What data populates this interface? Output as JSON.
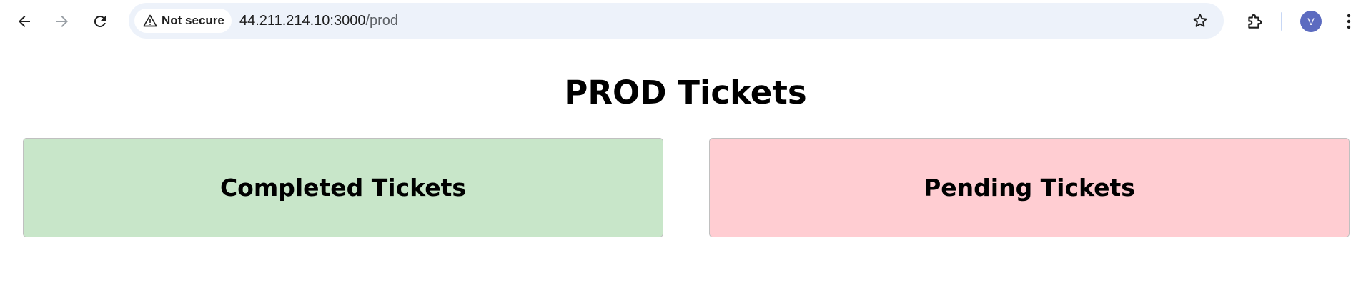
{
  "browser": {
    "security_label": "Not secure",
    "url_host": "44.211.214.10:3000",
    "url_path": "/prod",
    "avatar_letter": "V",
    "icons": {
      "back": "arrow-left-icon",
      "forward": "arrow-right-icon",
      "reload": "reload-icon",
      "security": "warning-triangle-icon",
      "bookmark": "star-icon",
      "extensions": "puzzle-piece-icon",
      "menu": "kebab-menu-icon"
    },
    "colors": {
      "omnibox": "#edf2fa",
      "avatar": "#5c6bc0"
    }
  },
  "page": {
    "title": "PROD Tickets",
    "cards": [
      {
        "label": "Completed Tickets",
        "color": "#c8e6c9"
      },
      {
        "label": "Pending Tickets",
        "color": "#ffcdd2"
      }
    ]
  }
}
